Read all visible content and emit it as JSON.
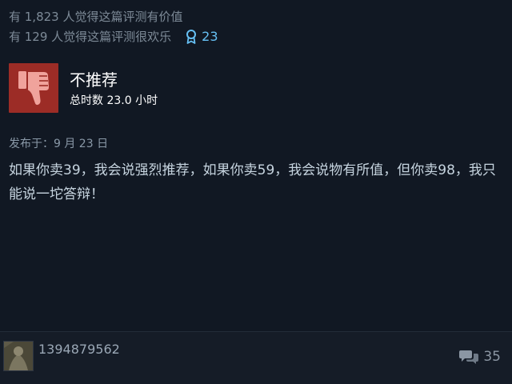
{
  "helpful": {
    "line1": "有 1,823 人觉得这篇评测有价值",
    "line2": "有 129 人觉得这篇评测很欢乐",
    "awards_count": "23"
  },
  "verdict": {
    "title": "不推荐",
    "hours": "总时数 23.0 小时"
  },
  "posted": "发布于：9 月 23 日",
  "review_text": "如果你卖39，我会说强烈推荐，如果你卖59，我会说物有所值，但你卖98，我只能说一坨答辩！",
  "author": {
    "name": "1394879562"
  },
  "comments_count": "35",
  "colors": {
    "background": "#111823",
    "thumb_down_bg": "#9c2c26",
    "award_accent": "#66c0f4"
  },
  "icons": {
    "thumb": "thumbs-down-icon",
    "award": "award-ribbon-icon",
    "comments": "comment-bubbles-icon"
  }
}
